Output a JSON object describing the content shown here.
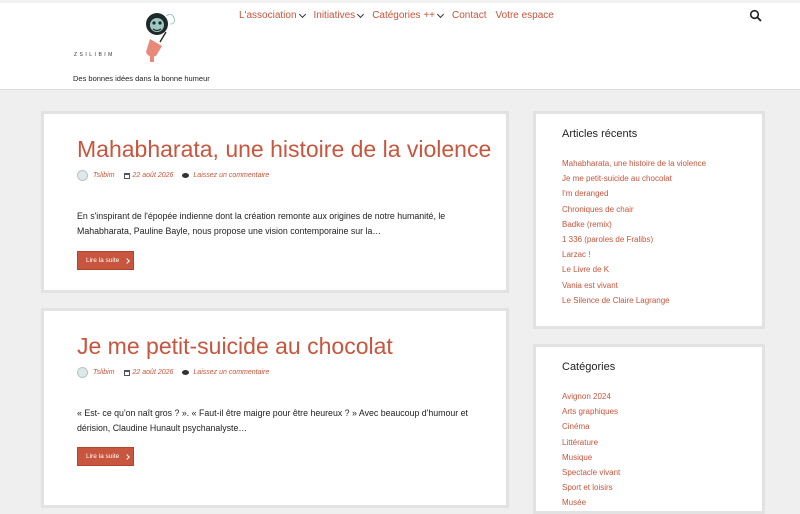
{
  "site": {
    "logo_text": "ZSILIBIM",
    "tagline": "Des bonnes idées dans la bonne humeur"
  },
  "nav": {
    "items": [
      {
        "label": "L'association",
        "has_submenu": true
      },
      {
        "label": "Initiatives",
        "has_submenu": true
      },
      {
        "label": "Catégories ++",
        "has_submenu": true
      },
      {
        "label": "Contact",
        "has_submenu": false
      },
      {
        "label": "Votre espace",
        "has_submenu": false
      }
    ]
  },
  "posts": [
    {
      "title": "Mahabharata, une histoire de la violence",
      "author": "Tslibim",
      "date": "22 août 2026",
      "comments": "Laissez un commentaire",
      "excerpt": "En s'inspirant de l'épopée indienne dont la création remonte aux origines de notre humanité, le Mahabharata, Pauline Bayle, nous propose une vision contemporaine sur la…",
      "read_more": "Lire la suite"
    },
    {
      "title": "Je me petit-suicide au chocolat",
      "author": "Tslibim",
      "date": "22 août 2026",
      "comments": "Laissez un commentaire",
      "excerpt": "« Est- ce qu'on naît gros ? ». « Faut-il être maigre pour être heureux ? » Avec beaucoup d'humour et dérision, Claudine Hunault psychanalyste…",
      "read_more": "Lire la suite"
    }
  ],
  "recent": {
    "title": "Articles récents",
    "items": [
      "Mahabharata, une histoire de la violence",
      "Je me petit-suicide au chocolat",
      "I'm deranged",
      "Chroniques de chair",
      "Badke (remix)",
      "1 336 (paroles de Fralibs)",
      "Larzac !",
      "Le Livre de K",
      "Vania est vivant",
      "Le Silence de Claire Lagrange"
    ]
  },
  "categories": {
    "title": "Catégories",
    "items": [
      "Avignon 2024",
      "Arts graphiques",
      "Cinéma",
      "Littérature",
      "Musique",
      "Spectacle vivant",
      "Sport et loisirs",
      "Musée"
    ]
  },
  "colors": {
    "accent": "#c8553d",
    "background": "#efefef",
    "card": "#ffffff"
  }
}
